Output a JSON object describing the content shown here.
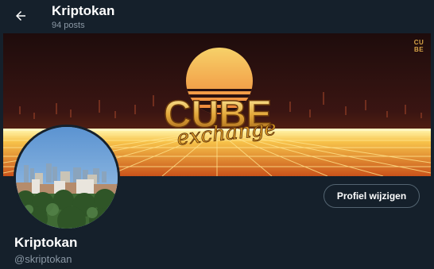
{
  "header": {
    "name": "Kriptokan",
    "post_count": "94 posts"
  },
  "banner": {
    "logo_main": "CUBE",
    "logo_sub": "exchange",
    "corner_mark_top": "CU",
    "corner_mark_bottom": "BE",
    "colors": {
      "sky": "#2a1110",
      "sun_top": "#f7d36a",
      "sun_bottom": "#f08a3a",
      "grid": "#f5b03a",
      "horizon": "#fff0a0",
      "logo_gold": "#e8b64a",
      "logo_script": "#d9a230"
    }
  },
  "avatar": {
    "description_icon": "city-skyline-photo"
  },
  "actions": {
    "edit_profile_label": "Profiel wijzigen"
  },
  "profile": {
    "display_name": "Kriptokan",
    "handle": "@skriptokan"
  },
  "icons": {
    "back": "arrow-left-icon"
  },
  "theme": {
    "background": "#15202b",
    "secondary_text": "#8b98a5",
    "border": "#536471"
  }
}
